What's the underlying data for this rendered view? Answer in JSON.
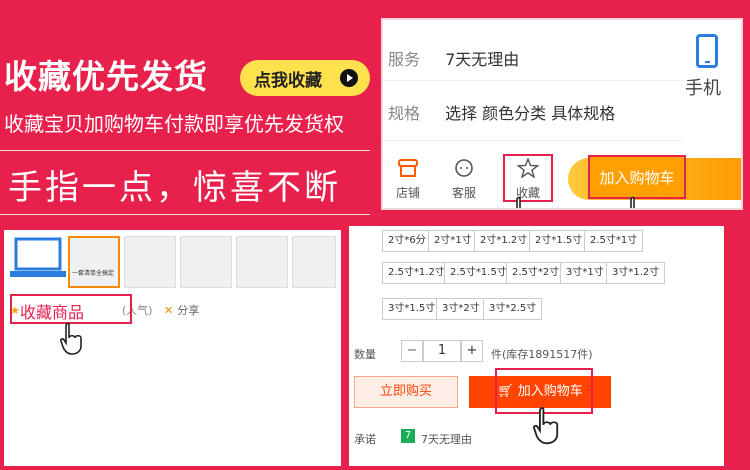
{
  "hero": {
    "title": "收藏优先发货",
    "button_label": "点我收藏",
    "subtitle": "收藏宝贝加购物车付款即享优先发货权",
    "slogan": "手指一点，惊喜不断"
  },
  "mobile": {
    "service_key": "服务",
    "service_value": "7天无理由",
    "spec_key": "规格",
    "spec_value": "选择 颜色分类 具体规格",
    "phone_label": "手机",
    "tabs": [
      {
        "label": "店铺",
        "icon": "store-icon"
      },
      {
        "label": "客服",
        "icon": "chat-icon"
      },
      {
        "label": "收藏",
        "icon": "star-icon"
      }
    ],
    "add_cart_label": "加入购物车"
  },
  "gallery": {
    "fav_label": "收藏商品",
    "fav_count": "(人气)",
    "share_label": "分享",
    "thumb_caption": "一套清单全搞定"
  },
  "spec": {
    "options": [
      "2寸*6分",
      "2寸*1寸",
      "2寸*1.2寸",
      "2寸*1.5寸",
      "2.5寸*1寸",
      "2.5寸*1.2寸",
      "2.5寸*1.5寸",
      "2.5寸*2寸",
      "3寸*1寸",
      "3寸*1.2寸",
      "3寸*1.5寸",
      "3寸*2寸",
      "3寸*2.5寸"
    ],
    "qty_label": "数量",
    "qty_minus": "−",
    "qty_value": "1",
    "qty_plus": "+",
    "stock_text": "件(库存1891517件)",
    "buy_now_label": "立即购买",
    "add_cart_label": "加入购物车",
    "promise_label": "承诺",
    "seven_badge": "7",
    "seven_text": "7天无理由"
  },
  "colors": {
    "brand_red": "#e8204c",
    "cta_orange": "#ff4400",
    "yellow": "#ffe14d",
    "phone_blue": "#2b7de0"
  }
}
